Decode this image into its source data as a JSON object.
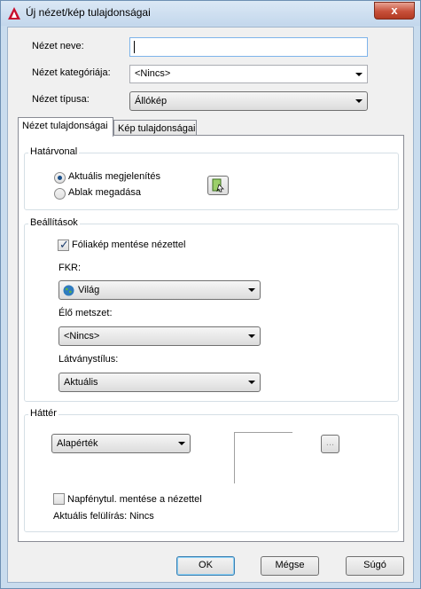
{
  "window": {
    "title": "Új nézet/kép tulajdonságai",
    "close_label": "x"
  },
  "header": {
    "view_name_label": "Nézet neve:",
    "view_name_value": "",
    "view_category_label": "Nézet kategóriája:",
    "view_category_value": "<Nincs>",
    "view_type_label": "Nézet típusa:",
    "view_type_value": "Állókép"
  },
  "tabs": [
    {
      "label": "Nézet tulajdonságai",
      "active": true
    },
    {
      "label": "Kép tulajdonságai",
      "active": false
    }
  ],
  "boundary": {
    "title": "Határvonal",
    "radio_current": "Aktuális megjelenítés",
    "radio_window": "Ablak megadása",
    "current_selected": true,
    "define_window_icon": "define-window-icon"
  },
  "settings": {
    "title": "Beállítások",
    "save_layer_snapshot": "Fóliakép mentése nézettel",
    "save_layer_snapshot_checked": true,
    "ucs_label": "FKR:",
    "ucs_value": "Világ",
    "ucs_icon": "globe-icon",
    "live_section_label": "Élő metszet:",
    "live_section_value": "<Nincs>",
    "visual_style_label": "Látványstílus:",
    "visual_style_value": "Aktuális"
  },
  "background": {
    "title": "Háttér",
    "type_value": "Alapérték",
    "browse_label": "...",
    "save_sun_label": "Napfénytul. mentése a nézettel",
    "save_sun_checked": false,
    "current_override": "Aktuális felülírás: Nincs"
  },
  "footer": {
    "ok_label": "OK",
    "cancel_label": "Mégse",
    "help_label": "Súgó"
  },
  "colors": {
    "app_icon_red": "#c8102e",
    "frame_blue": "#c9dcee",
    "close_red": "#c7503a"
  }
}
